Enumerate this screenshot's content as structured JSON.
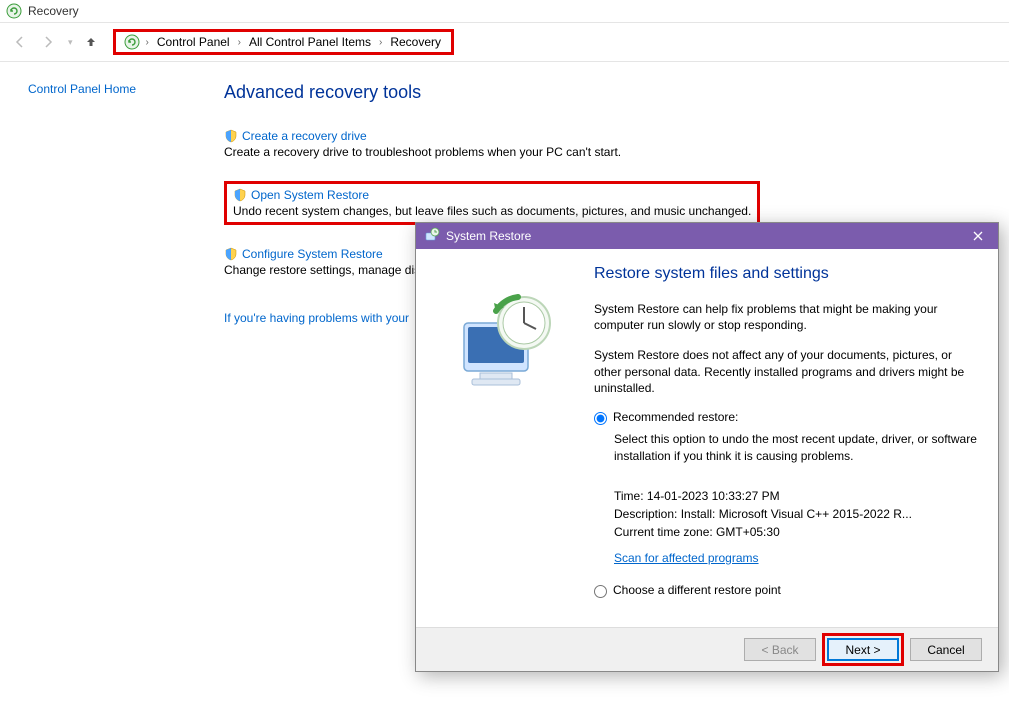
{
  "window": {
    "title": "Recovery"
  },
  "breadcrumb": {
    "items": [
      "Control Panel",
      "All Control Panel Items",
      "Recovery"
    ]
  },
  "sidebar": {
    "home_link": "Control Panel Home"
  },
  "page": {
    "heading": "Advanced recovery tools",
    "tools": [
      {
        "link": "Create a recovery drive",
        "desc": "Create a recovery drive to troubleshoot problems when your PC can't start."
      },
      {
        "link": "Open System Restore",
        "desc": "Undo recent system changes, but leave files such as documents, pictures, and music unchanged."
      },
      {
        "link": "Configure System Restore",
        "desc": "Change restore settings, manage dis"
      }
    ],
    "troubleshoot_link": "If you're having problems with your"
  },
  "dialog": {
    "title": "System Restore",
    "heading": "Restore system files and settings",
    "p1": "System Restore can help fix problems that might be making your computer run slowly or stop responding.",
    "p2": "System Restore does not affect any of your documents, pictures, or other personal data. Recently installed programs and drivers might be uninstalled.",
    "recommended_label": "Recommended restore:",
    "recommended_desc": "Select this option to undo the most recent update, driver, or software installation if you think it is causing problems.",
    "time_label": "Time: 14-01-2023 10:33:27 PM",
    "desc_label": "Description: Install: Microsoft Visual C++ 2015-2022 R...",
    "tz_label": "Current time zone: GMT+05:30",
    "scan_link": "Scan for affected programs",
    "different_label": "Choose a different restore point",
    "buttons": {
      "back": "< Back",
      "next": "Next >",
      "cancel": "Cancel"
    }
  }
}
